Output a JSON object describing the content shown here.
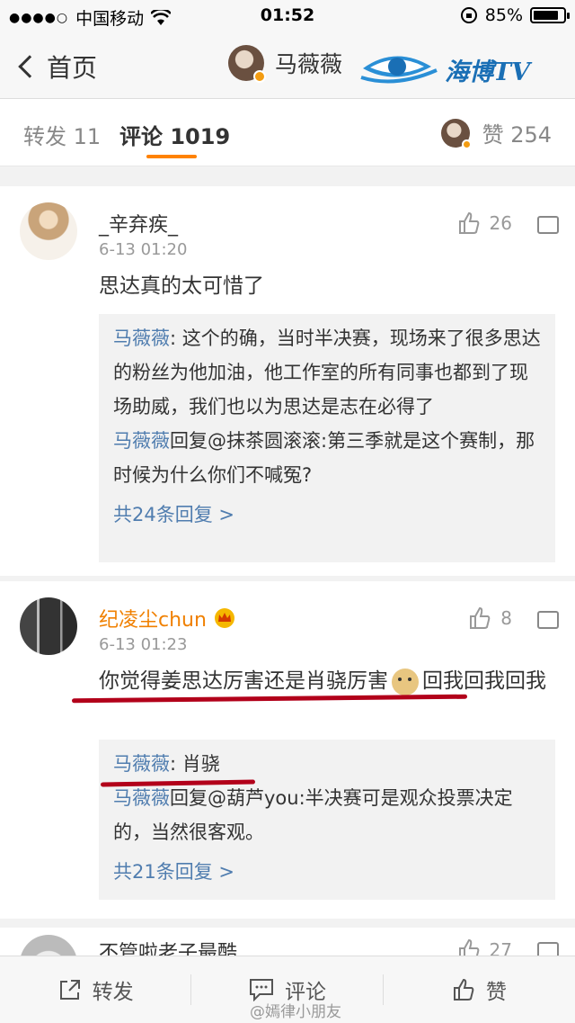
{
  "status": {
    "signal": "●●●●○",
    "carrier": "中国移动",
    "time": "01:52",
    "battery": "85%",
    "battery_level": 0.85
  },
  "nav": {
    "back": "首页",
    "username": "马薇薇",
    "logo_text": "海博TV"
  },
  "tabs": {
    "repost": "转发 11",
    "comments": "评论 1019",
    "likes": "赞 254"
  },
  "comments": [
    {
      "name": "_辛弃疾_",
      "time": "6-13 01:20",
      "likes": "26",
      "text": "思达真的太可惜了",
      "replies": [
        {
          "name": "马薇薇",
          "text": ": 这个的确，当时半决赛，现场来了很多思达的粉丝为他加油，他工作室的所有同事也都到了现场助威，我们也以为思达是志在必得了"
        },
        {
          "name": "马薇薇",
          "text": "回复@抹茶圆滚滚:第三季就是这个赛制，那时候为什么你们不喊冤?"
        }
      ],
      "more": "共24条回复 >"
    },
    {
      "name": "纪凌尘chun",
      "time": "6-13 01:23",
      "likes": "8",
      "text_a": "你觉得姜思达厉害还是肖骁厉害",
      "text_b": "回我回我回我",
      "replies": [
        {
          "name": "马薇薇",
          "text": ": 肖骁"
        },
        {
          "name": "马薇薇",
          "text": "回复@葫芦you:半决赛可是观众投票决定的，当然很客观。"
        }
      ],
      "more": "共21条回复 >"
    },
    {
      "name": "不管啦老子最酷",
      "likes": "27"
    }
  ],
  "bottom": {
    "repost": "转发",
    "comment": "评论",
    "like": "赞"
  },
  "watermark": "@嫣律小朋友",
  "colors": {
    "accent": "#ff8200",
    "link": "#507daf",
    "underline_red": "#b2001a",
    "vip_name": "#f08000"
  }
}
